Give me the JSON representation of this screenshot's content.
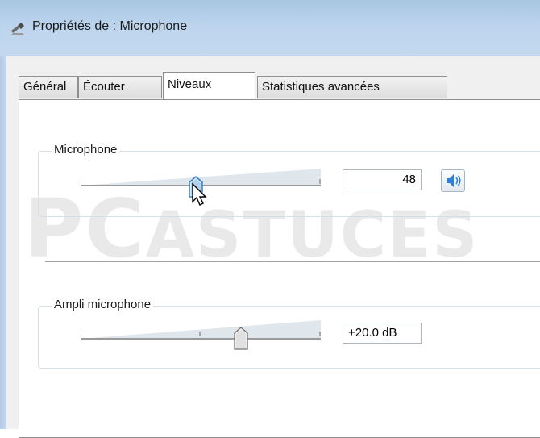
{
  "window": {
    "title": "Propriétés de : Microphone",
    "icon": "microphone-icon"
  },
  "tabs": [
    {
      "label": "Général",
      "active": false
    },
    {
      "label": "Écouter",
      "active": false
    },
    {
      "label": "Niveaux",
      "active": true
    },
    {
      "label": "Statistiques avancées",
      "active": false
    }
  ],
  "watermark": {
    "prefix": "PC",
    "text": "ASTUCES"
  },
  "levels": {
    "microphone": {
      "label": "Microphone",
      "value": "48",
      "slider_fraction": 0.48,
      "mute_icon": "speaker-icon"
    },
    "boost": {
      "label": "Ampli microphone",
      "value": "+20.0 dB",
      "slider_fraction": 0.667
    }
  },
  "colors": {
    "titlebar": "#bcd4ec",
    "thumb_hover": "#5f9bd3"
  }
}
